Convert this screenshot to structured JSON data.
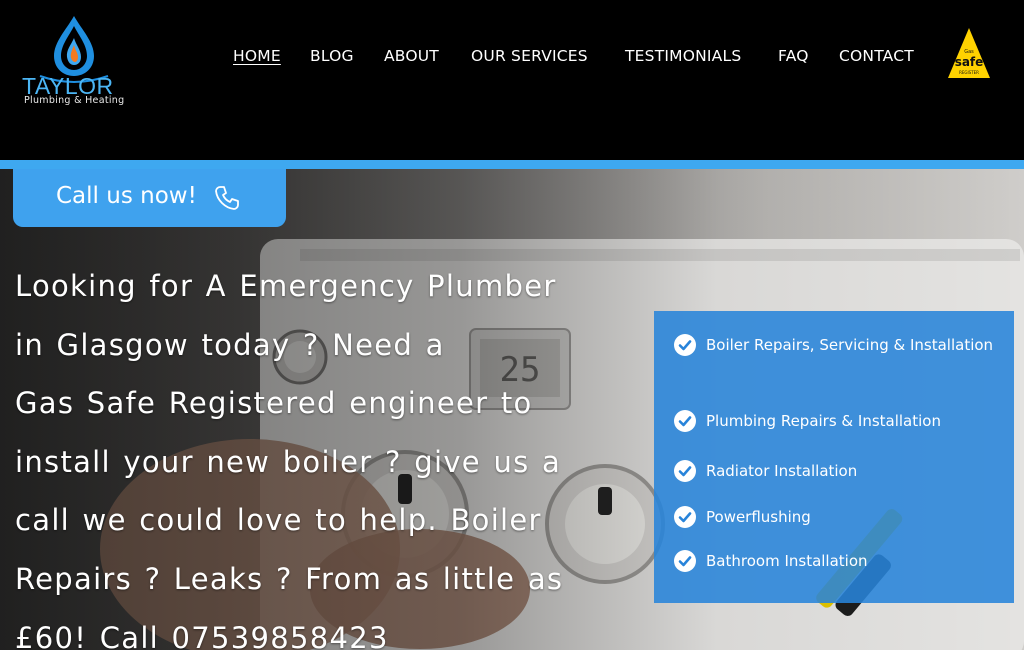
{
  "brand": {
    "name": "TAYLOR",
    "tagline": "Plumbing & Heating",
    "accent": "#3ea8f0"
  },
  "nav": {
    "items": [
      {
        "label": "HOME",
        "active": true
      },
      {
        "label": "BLOG"
      },
      {
        "label": "ABOUT"
      },
      {
        "label": "OUR SERVICES"
      },
      {
        "label": "TESTIMONIALS"
      },
      {
        "label": "FAQ"
      },
      {
        "label": "CONTACT"
      }
    ]
  },
  "badge": {
    "top": "Gas",
    "main": "safe",
    "bottom": "REGISTER"
  },
  "hero": {
    "call_label": "Call us now!",
    "call_icon": "phone-icon",
    "lines": [
      "Looking for A Emergency Plumber",
      "in Glasgow today ? Need a",
      "Gas Safe Registered engineer to",
      "install your new boiler ? give us a",
      "call we could love to help. Boiler",
      "Repairs ? Leaks ? From as little as",
      "£60! Call 07539858423"
    ]
  },
  "services": [
    {
      "label": "Boiler Repairs, Servicing & Installation"
    },
    {
      "label": "Plumbing Repairs & Installation"
    },
    {
      "label": "Radiator Installation"
    },
    {
      "label": "Powerflushing"
    },
    {
      "label": "Bathroom Installation"
    }
  ],
  "boiler_display": {
    "readout": "25"
  }
}
